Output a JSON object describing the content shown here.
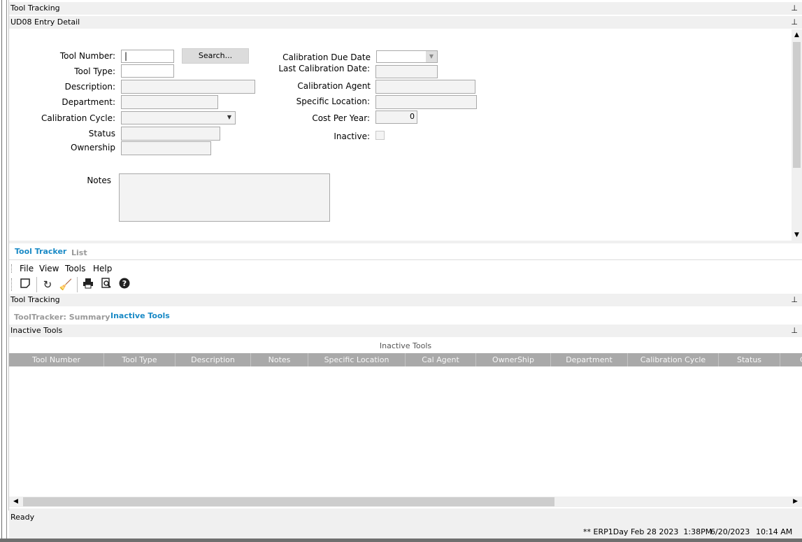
{
  "panels": {
    "tool_tracking_top": "Tool Tracking",
    "entry_detail": "UD08 Entry Detail",
    "tool_tracking_bottom": "Tool Tracking",
    "inactive_tools": "Inactive Tools",
    "pin_glyph": "📌"
  },
  "form": {
    "tool_number_label": "Tool Number:",
    "tool_number_value": "",
    "search_button": "Search...",
    "tool_type_label": "Tool Type:",
    "description_label": "Description:",
    "department_label": "Department:",
    "calibration_cycle_label": "Calibration Cycle:",
    "status_label": "Status",
    "ownership_label": "Ownership",
    "notes_label": "Notes",
    "calibration_due_date_label": "Calibration Due Date",
    "last_calibration_date_label": "Last Calibration Date:",
    "calibration_agent_label": "Calibration Agent",
    "specific_location_label": "Specific Location:",
    "cost_per_year_label": "Cost Per Year:",
    "cost_per_year_value": "0",
    "inactive_label": "Inactive:",
    "inactive_checked": false
  },
  "tabs": {
    "main": [
      {
        "label": "Tool Tracker",
        "active": true
      },
      {
        "label": "List",
        "active": false
      }
    ],
    "sub": [
      {
        "label": "ToolTracker: Summary",
        "active": false
      },
      {
        "label": "Inactive Tools",
        "active": true
      }
    ]
  },
  "menu": [
    "File",
    "View",
    "Tools",
    "Help"
  ],
  "toolbar": [
    {
      "name": "new-icon"
    },
    {
      "name": "refresh-icon"
    },
    {
      "name": "clear-icon"
    },
    {
      "name": "print-icon"
    },
    {
      "name": "print-preview-icon"
    },
    {
      "name": "help-icon"
    }
  ],
  "grid": {
    "caption": "Inactive Tools",
    "columns": [
      "Tool Number",
      "Tool Type",
      "Description",
      "Notes",
      "Specific Location",
      "Cal Agent",
      "OwnerShip",
      "Department",
      "Calibration Cycle",
      "Status",
      "C"
    ],
    "rows": []
  },
  "status": {
    "ready": "Ready",
    "environment": "** ERP1Day Feb 28 2023  1:38PM",
    "date": "6/20/2023",
    "time": "10:14 AM"
  },
  "colors": {
    "accent_tab": "#1a8ac6",
    "grid_header": "#a9a9a9"
  }
}
